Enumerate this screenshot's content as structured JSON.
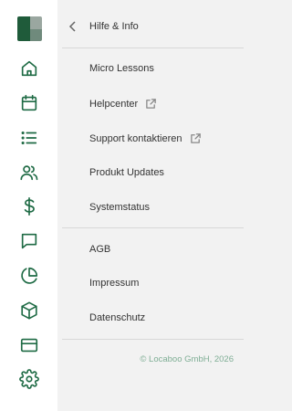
{
  "brand": {
    "logo_icon": "locaboo-logo"
  },
  "rail": {
    "icons": [
      "home-icon",
      "calendar-icon",
      "list-icon",
      "users-icon",
      "dollar-icon",
      "chat-icon",
      "pie-chart-icon",
      "box-icon",
      "card-icon",
      "settings-icon"
    ]
  },
  "panel": {
    "title": "Hilfe & Info",
    "sections": [
      {
        "items": [
          {
            "label": "Micro Lessons"
          },
          {
            "label": "Helpcenter",
            "external": true
          },
          {
            "label": "Support kontaktieren",
            "external": true
          },
          {
            "label": "Produkt Updates"
          },
          {
            "label": "Systemstatus"
          }
        ]
      },
      {
        "items": [
          {
            "label": "AGB"
          },
          {
            "label": "Impressum"
          },
          {
            "label": "Datenschutz"
          }
        ]
      }
    ],
    "footer": "© Locaboo GmbH, 2026"
  },
  "colors": {
    "accent": "#1f6b45",
    "footer_text": "#7fae95",
    "panel_bg": "#f2f2f2"
  }
}
